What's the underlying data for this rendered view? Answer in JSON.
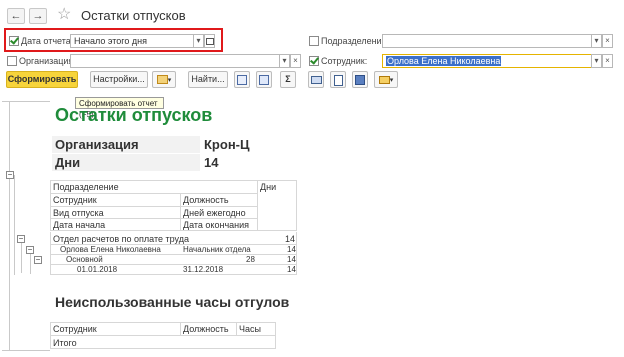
{
  "window": {
    "title": "Остатки отпусков"
  },
  "nav": {
    "back": "←",
    "forward": "→",
    "favorite": "☆"
  },
  "filters": {
    "report_date": {
      "label": "Дата отчета:",
      "value": "Начало этого дня",
      "checked": true
    },
    "organization": {
      "label": "Организация:",
      "value": "",
      "checked": false
    },
    "department": {
      "label": "Подразделение:",
      "value": "",
      "checked": false
    },
    "employee": {
      "label": "Сотрудник:",
      "value": "Орлова Елена Николаевна",
      "checked": true
    }
  },
  "toolbar": {
    "generate_label": "Сформировать",
    "settings_label": "Настройки...",
    "find_label": "Найти...",
    "sum_symbol": "Σ",
    "tooltip": "Сформировать отчет (F5)"
  },
  "report": {
    "title": "Остатки отпусков",
    "params": [
      {
        "label": "Организация",
        "value": "Крон-Ц"
      },
      {
        "label": "Дни",
        "value": "14"
      }
    ],
    "headers": {
      "department": "Подразделение",
      "days": "Дни",
      "employee": "Сотрудник",
      "position": "Должность",
      "vacation_type": "Вид отпуска",
      "days_yearly": "Дней ежегодно",
      "start_date": "Дата начала",
      "end_date": "Дата окончания"
    },
    "rows": {
      "department": {
        "name": "Отдел расчетов по оплате труда",
        "days": "14"
      },
      "employee": {
        "name": "Орлова Елена Николаевна",
        "position": "Начальник отдела",
        "days": "14"
      },
      "vacation": {
        "type": "Основной",
        "yearly": "28",
        "days": "14"
      },
      "period": {
        "start": "01.01.2018",
        "end": "31.12.2018",
        "days": "14"
      }
    },
    "section2": {
      "title": "Неиспользованные часы отгулов",
      "headers": {
        "employee": "Сотрудник",
        "position": "Должность",
        "hours": "Часы"
      },
      "total": "Итого"
    }
  },
  "colors": {
    "accent": "#1f8c3b",
    "primary_button": "#f7d43b",
    "highlight_box": "#e0191b",
    "selection": "#3b6fc9"
  }
}
